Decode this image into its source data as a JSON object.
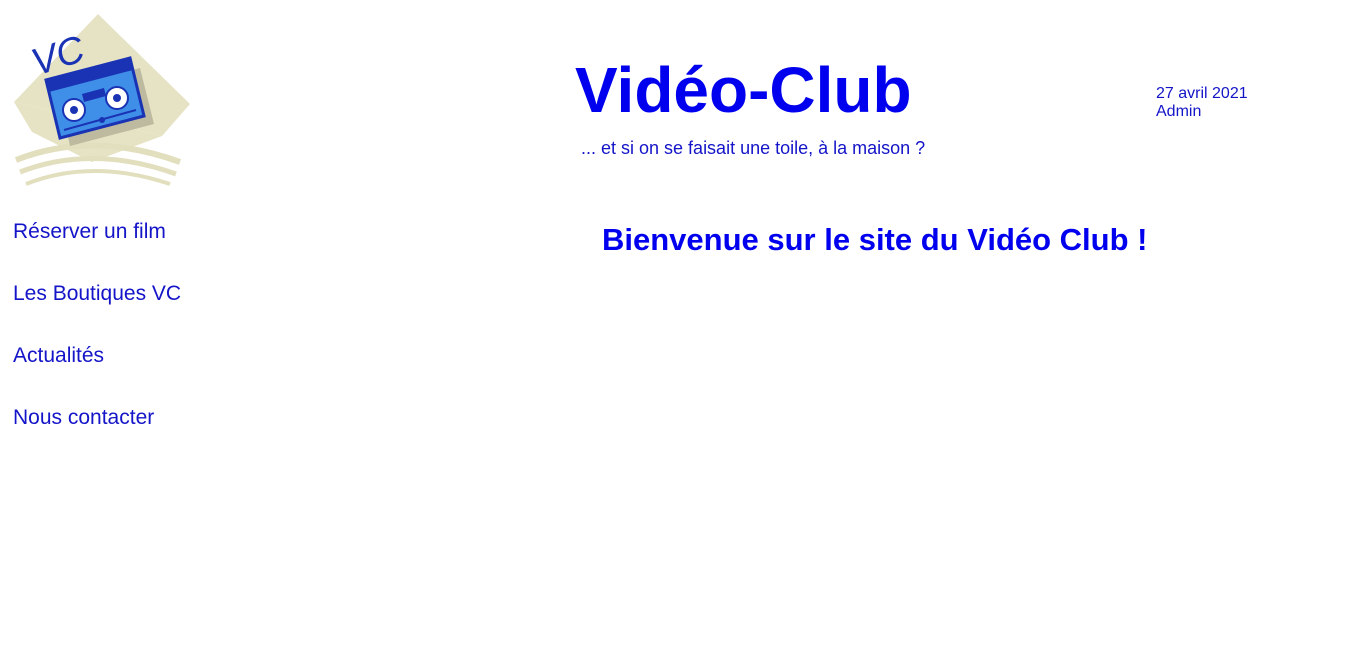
{
  "header": {
    "logo_text": "VC",
    "title": "Vidéo-Club",
    "tagline": "... et si on se faisait une toile, à la maison ?",
    "date": "27 avril 2021",
    "user": "Admin"
  },
  "nav": {
    "items": [
      {
        "label": "Réserver un film"
      },
      {
        "label": "Les Boutiques VC"
      },
      {
        "label": "Actualités"
      },
      {
        "label": "Nous contacter"
      }
    ]
  },
  "main": {
    "welcome": "Bienvenue sur le site du Vidéo Club !"
  },
  "colors": {
    "link": "#1414c8",
    "title": "#0000ee",
    "logo_bg": "#e6e3c4",
    "cassette": "#3f8fe8",
    "cassette_dark": "#1a32b4"
  }
}
